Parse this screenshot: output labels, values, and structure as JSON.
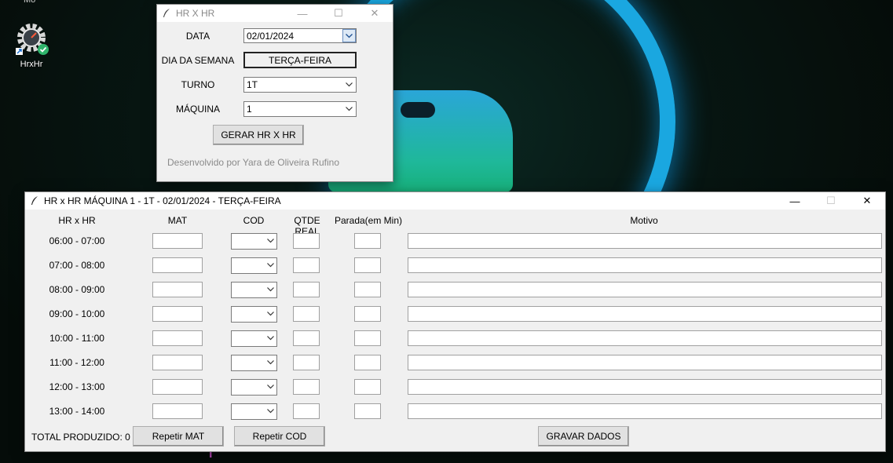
{
  "desktop": {
    "top_fragment": "Mo",
    "icon_label": "HrxHr"
  },
  "win1": {
    "title": "HR X HR",
    "fields": {
      "data_label": "DATA",
      "data_value": "02/01/2024",
      "dia_label": "DIA DA SEMANA",
      "dia_value": "TERÇA-FEIRA",
      "turno_label": "TURNO",
      "turno_value": "1T",
      "maquina_label": "MÁQUINA",
      "maquina_value": "1"
    },
    "button_gerar": "GERAR HR X HR",
    "credit": "Desenvolvido por Yara de Oliveira Rufino"
  },
  "win2": {
    "title": "HR x HR MÁQUINA 1 - 1T - 02/01/2024 - TERÇA-FEIRA",
    "headers": {
      "hr": "HR x HR",
      "mat": "MAT",
      "cod": "COD",
      "qtde": "QTDE REAL",
      "parada": "Parada(em Min)",
      "motivo": "Motivo"
    },
    "rows": [
      {
        "time": "06:00 - 07:00"
      },
      {
        "time": "07:00 - 08:00"
      },
      {
        "time": "08:00 - 09:00"
      },
      {
        "time": "09:00 - 10:00"
      },
      {
        "time": "10:00 - 11:00"
      },
      {
        "time": "11:00 - 12:00"
      },
      {
        "time": "12:00 - 13:00"
      },
      {
        "time": "13:00 - 14:00"
      }
    ],
    "total_produzido": "TOTAL PRODUZIDO: 0",
    "btn_repetir_mat": "Repetir MAT",
    "btn_repetir_cod": "Repetir COD",
    "btn_gravar": "GRAVAR DADOS"
  },
  "colors": {
    "window_bg": "#f0f0f0",
    "ring": "#1aa7e0"
  },
  "icons": [
    "feather-icon",
    "minimize-icon",
    "maximize-icon",
    "close-icon",
    "chevron-down-icon",
    "gear-app-icon"
  ]
}
